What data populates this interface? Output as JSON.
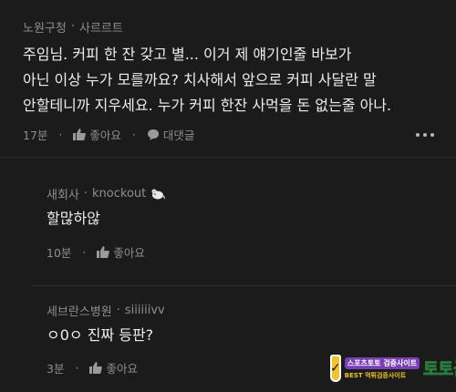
{
  "colors": {
    "background": "#1b1b1b",
    "text": "#ededed",
    "muted": "#8e8e8e",
    "divider": "#2d2d2d"
  },
  "comment": {
    "nickname": "노원구청",
    "separator": "·",
    "title": "사르르트",
    "lines": [
      "주임님. 커피 한 잔 갖고 별... 이거 제 얘기인줄 바보가",
      "아닌 이상 누가 모를까요? 치사해서 앞으로 커피 사달란 말",
      "안할테니까 지우세요. 누가 커피 한잔 사먹을 돈 없는줄 아나."
    ],
    "time": "17분",
    "like_label": "좋아요",
    "reply_label": "대댓글",
    "more_icon": "more-dots-icon"
  },
  "replies": [
    {
      "nickname": "새회사",
      "separator": "·",
      "title": "knockout",
      "title_icon": "mouse-icon",
      "text": "할많하않",
      "time": "10분",
      "like_label": "좋아요"
    },
    {
      "nickname": "세브란스병원",
      "separator": "·",
      "title": "siiiiiivv",
      "text": "ㅇ0ㅇ 진짜 등판?",
      "time": "3분",
      "like_label": "좋아요"
    }
  ],
  "watermark": {
    "line1": "스포츠토토 검증사이트",
    "line2": "BEST 먹튀검증사이트",
    "big": "토토군"
  }
}
